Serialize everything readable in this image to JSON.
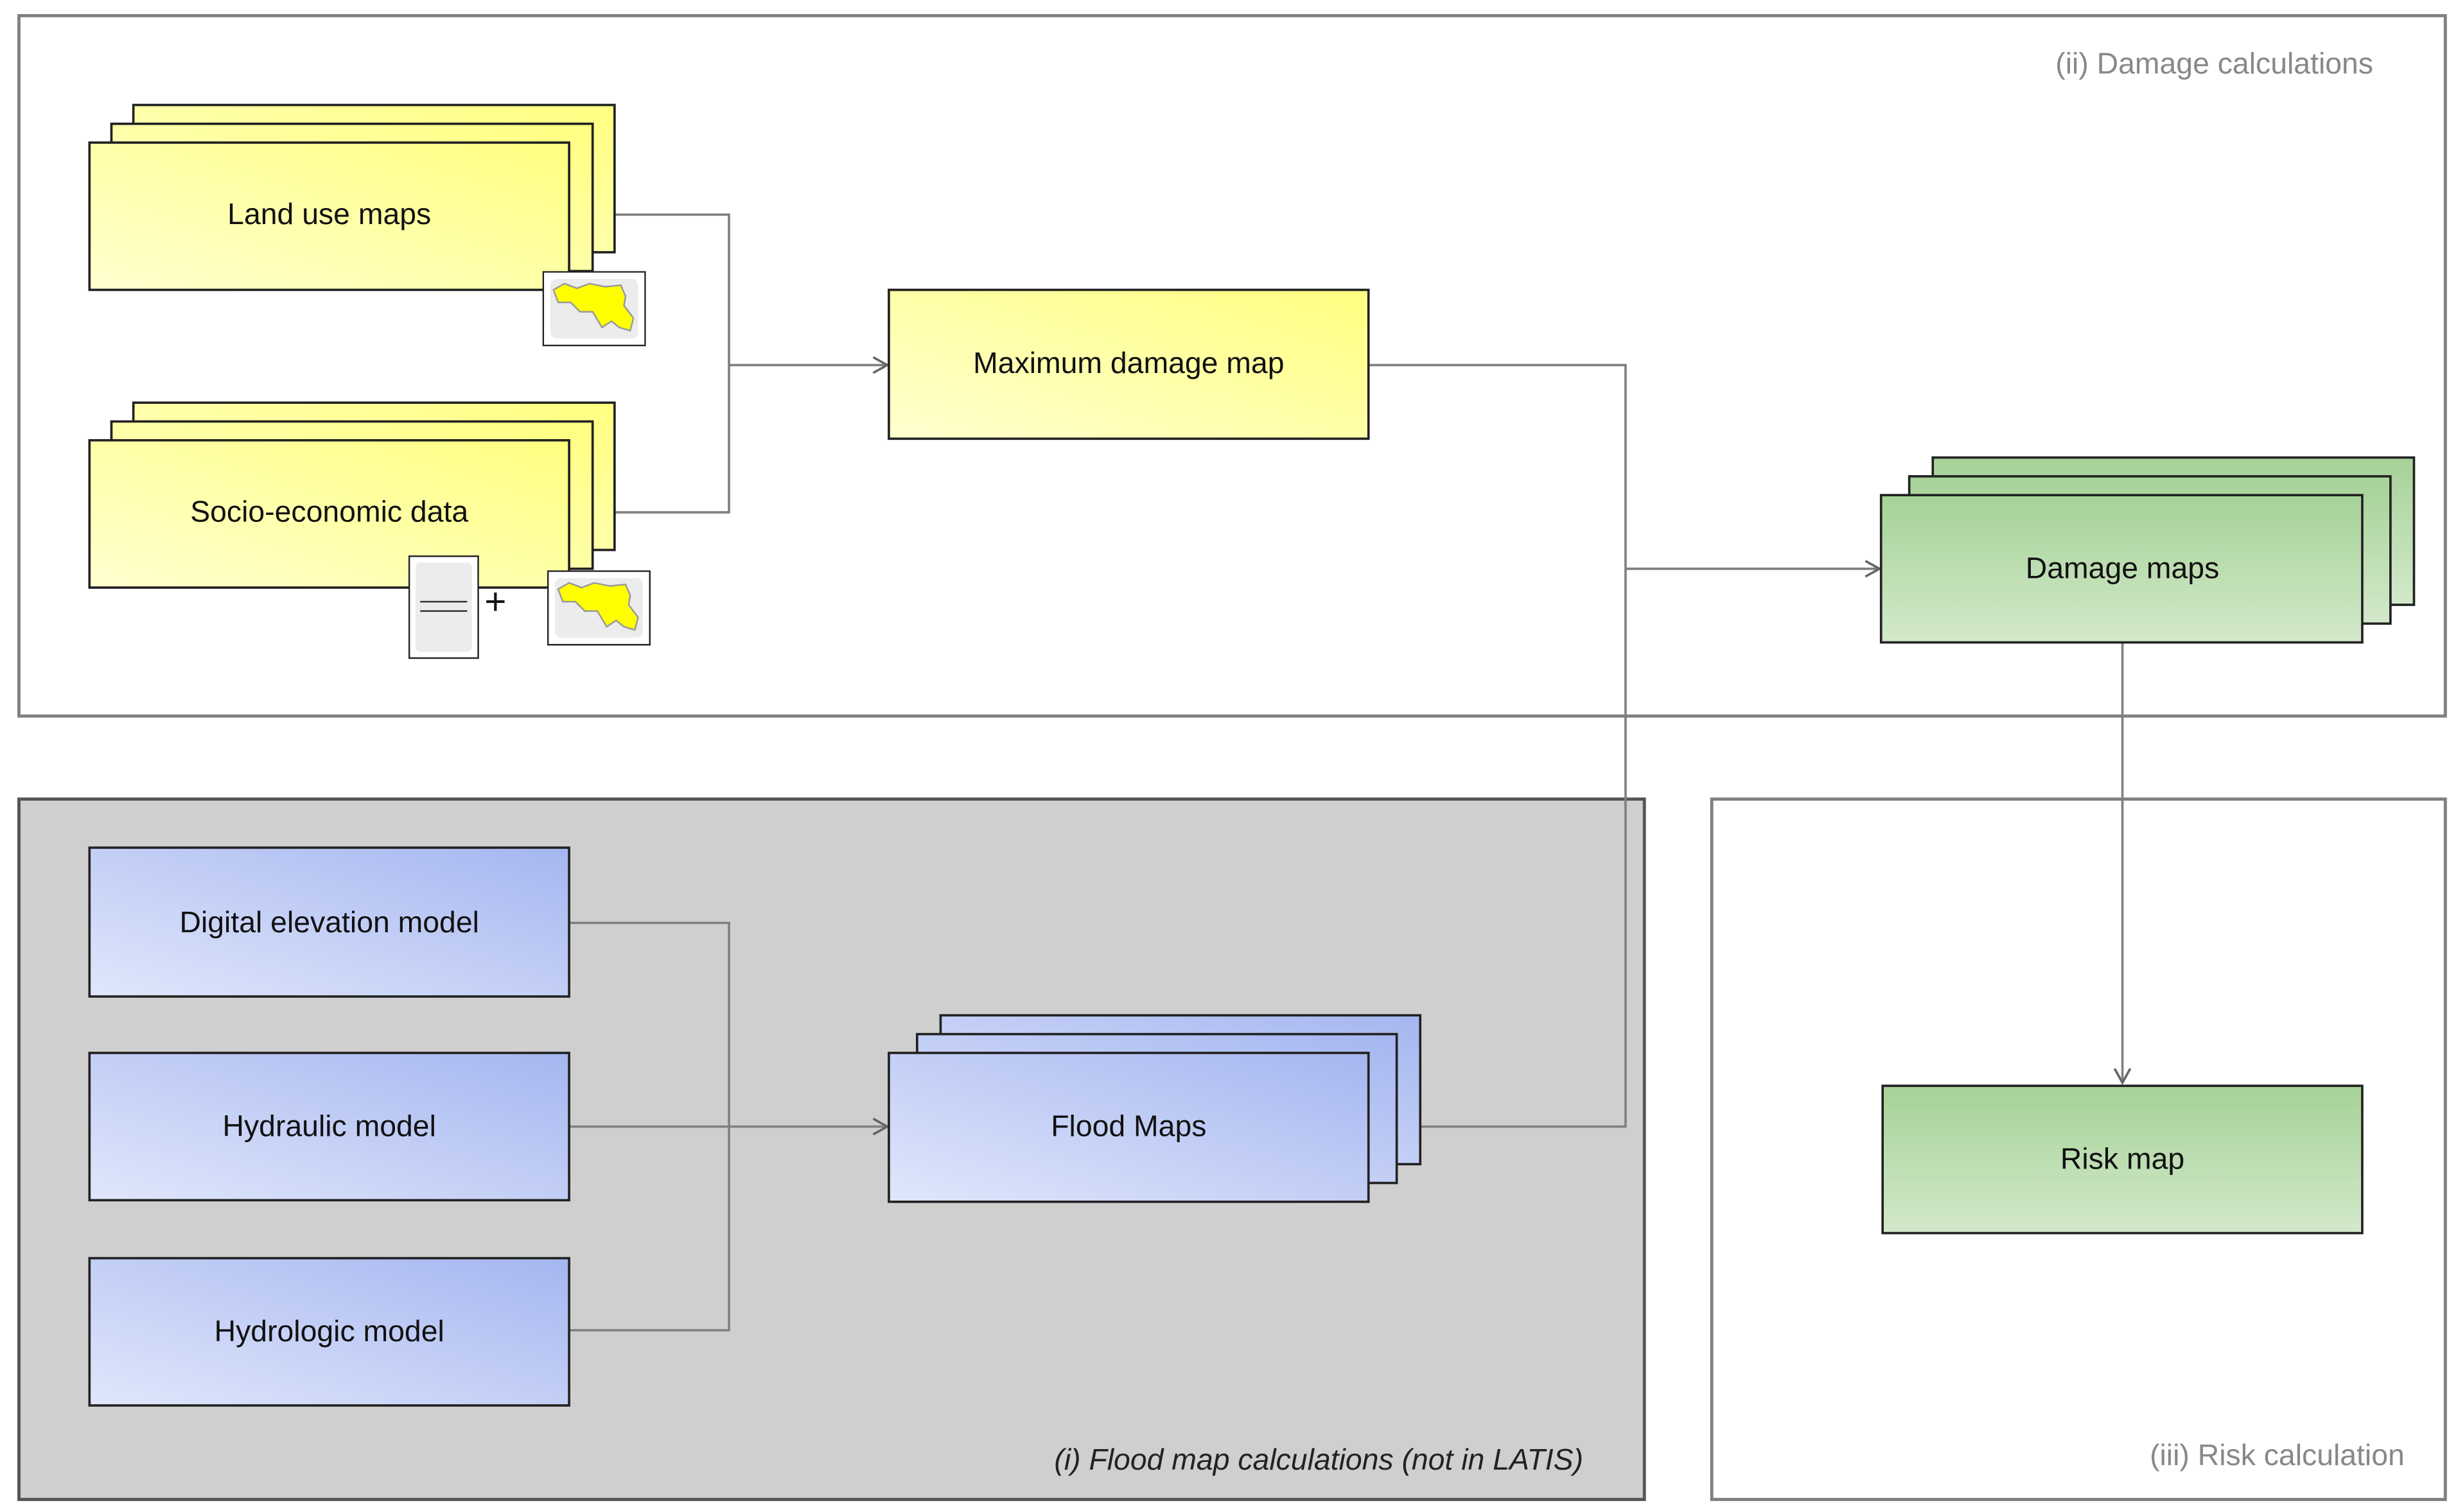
{
  "sections": {
    "damage": "(ii) Damage calculations",
    "flood": "(i) Flood map calculations (not in LATIS)",
    "risk": "(iii) Risk calculation"
  },
  "nodes": {
    "land_use": "Land use maps",
    "socio": "Socio-economic data",
    "max_damage": "Maximum damage map",
    "damage_maps": "Damage maps",
    "risk_map": "Risk map",
    "dem": "Digital elevation model",
    "hydraulic": "Hydraulic model",
    "hydrologic": "Hydrologic model",
    "flood_maps": "Flood Maps"
  },
  "symbols": {
    "plus": "+"
  },
  "colors": {
    "yellow": "#ffff88",
    "green": "#a8d49a",
    "blue": "#a9b9f0",
    "flood_section_bg": "#cfcfcf"
  }
}
